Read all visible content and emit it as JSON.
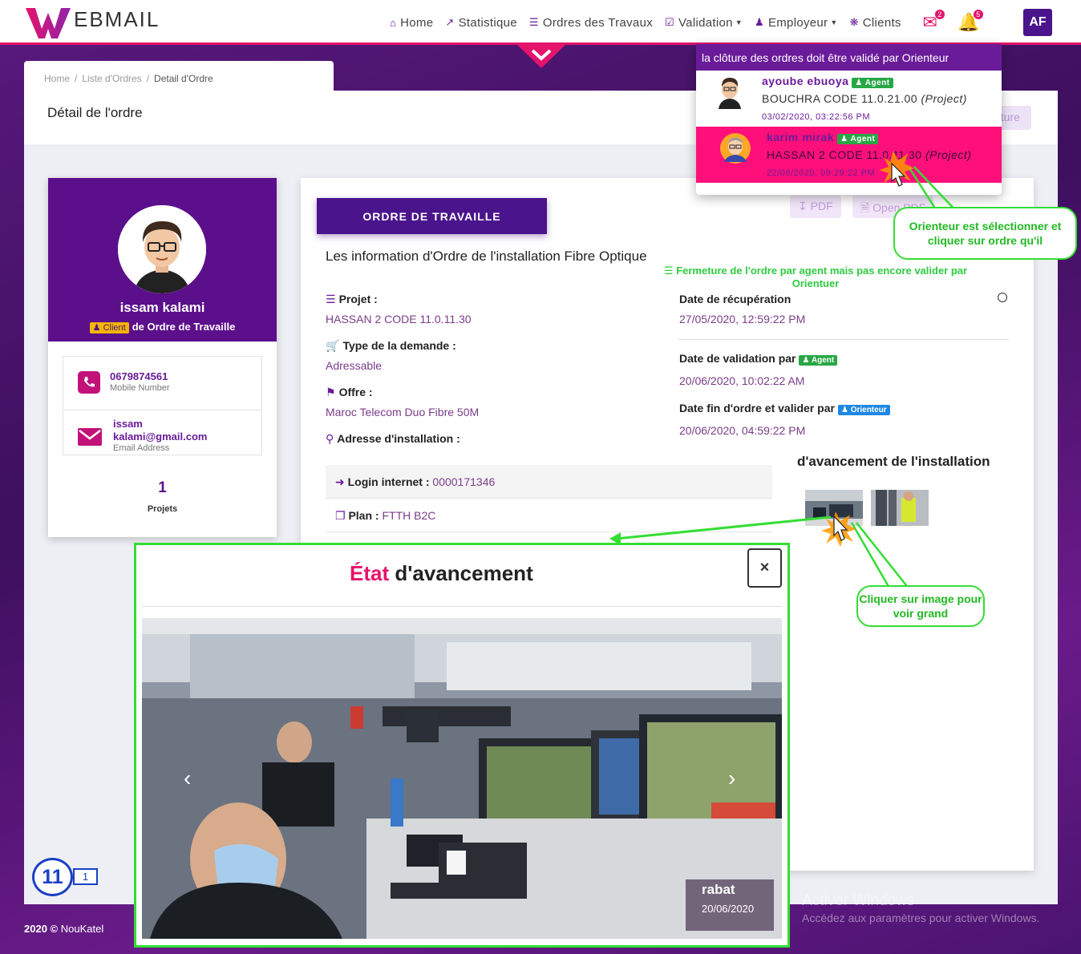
{
  "navbar": {
    "logo_text": "EBMAIL",
    "items": [
      {
        "label": "Home",
        "icon": "home-icon"
      },
      {
        "label": "Statistique",
        "icon": "chart-icon"
      },
      {
        "label": "Ordres des Travaux",
        "icon": "list-icon"
      },
      {
        "label": "Validation",
        "icon": "check-square-icon"
      },
      {
        "label": "Employeur",
        "icon": "user-icon"
      },
      {
        "label": "Clients",
        "icon": "users-icon"
      }
    ],
    "mail_badge": "2",
    "bell_badge": "5",
    "user_initials": "AF"
  },
  "breadcrumb": {
    "home": "Home",
    "list": "Liste d'Ordres",
    "current": "Detail d'Ordre"
  },
  "page_title": "Détail de l'ordre",
  "cloture_button": "ôture",
  "profile": {
    "name": "issam kalami",
    "role_badge": "Client",
    "role_text": "de Ordre de Travaille",
    "phone": "0679874561",
    "phone_label": "Mobile Number",
    "email_line1": "issam",
    "email_line2": "kalami@gmail.com",
    "email_label": "Email Address",
    "projects_count": "1",
    "projects_label": "Projets"
  },
  "order": {
    "tab_label": "ORDRE DE TRAVAILLE",
    "pdf_label": "PDF",
    "open_pdf_label": "Open PDF",
    "section_title": "Les information d'Ordre de l'installation Fibre Optique",
    "fermeture_note": "Fermeture de l'ordre par agent mais pas encore valider par Orientuer",
    "projet_label": "Projet :",
    "projet_value": "HASSAN 2 CODE 11.0.11.30",
    "type_label": "Type de la demande :",
    "type_value": "Adressable",
    "offre_label": "Offre :",
    "offre_value": "Maroc Telecom Duo Fibre 50M",
    "adresse_label": "Adresse d'installation :",
    "login_label": "Login internet :",
    "login_value": "0000171346",
    "plan_label": "Plan :",
    "plan_value": "FTTH B2C",
    "date_recup_label": "Date de récupération",
    "date_recup_value": "27/05/2020, 12:59:22 PM",
    "date_valid_label": "Date de validation par",
    "date_valid_badge": "Agent",
    "date_valid_value": "20/06/2020, 10:02:22 AM",
    "date_fin_label": "Date fin d'ordre et valider par",
    "date_fin_badge": "Orienteur",
    "date_fin_value": "20/06/2020, 04:59:22 PM",
    "avancement_title": "d'avancement de l'installation"
  },
  "notifications": {
    "header": "la clôture des ordres doit être validé par Orienteur",
    "items": [
      {
        "name": "ayoube ebuoya",
        "badge": "Agent",
        "order": "BOUCHRA CODE 11.0.21.00",
        "project": "(Project)",
        "date": "03/02/2020, 03:22:56 PM"
      },
      {
        "name": "karim mirak",
        "badge": "Agent",
        "order": "HASSAN 2 CODE 11.0.11.30",
        "project": "(Project)",
        "date": "22/06/2020, 09:29:22 PM"
      }
    ]
  },
  "callouts": {
    "orienteur": "Orienteur est sélectionner et cliquer sur ordre qu'il",
    "image": "Cliquer sur image pour voir grand"
  },
  "modal": {
    "title_highlight": "État",
    "title_rest": "d'avancement",
    "close": "×",
    "caption_city": "rabat",
    "caption_date": "20/06/2020"
  },
  "pager": {
    "big": "11",
    "small": "1"
  },
  "footer": {
    "year": "2020 ©",
    "brand": "NouKatel"
  },
  "windows": {
    "line1": "Activer Windows",
    "line2": "Accédez aux paramètres pour activer Windows."
  },
  "colors": {
    "primary": "#4a148c",
    "accent": "#e4136b",
    "callout": "#33dd33"
  }
}
